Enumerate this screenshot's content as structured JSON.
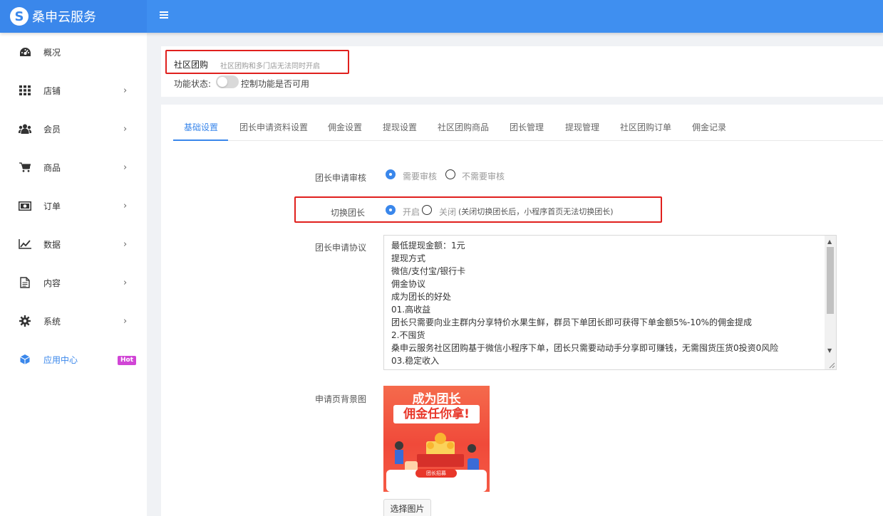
{
  "app": {
    "name": "桑申云服务",
    "logo_letter": "S"
  },
  "topbar": {
    "menu_icon": "hamburger-icon"
  },
  "sidebar": {
    "items": [
      {
        "label": "概况",
        "icon": "dashboard-icon",
        "arrow": ""
      },
      {
        "label": "店铺",
        "icon": "grid-icon",
        "arrow": "›"
      },
      {
        "label": "会员",
        "icon": "users-icon",
        "arrow": "›"
      },
      {
        "label": "商品",
        "icon": "cart-icon",
        "arrow": "›"
      },
      {
        "label": "订单",
        "icon": "money-icon",
        "arrow": "›"
      },
      {
        "label": "数据",
        "icon": "chart-line-icon",
        "arrow": "›"
      },
      {
        "label": "内容",
        "icon": "document-icon",
        "arrow": "›"
      },
      {
        "label": "系统",
        "icon": "gear-icon",
        "arrow": "›"
      },
      {
        "label": "应用中心",
        "icon": "cube-icon",
        "badge": "Hot",
        "active": true
      }
    ]
  },
  "header": {
    "title": "社区团购",
    "subtitle": "社区团购和多门店无法同时开启",
    "function_status_label": "功能状态:",
    "function_status_on": false,
    "function_status_hint": "控制功能是否可用"
  },
  "tabs": [
    "基础设置",
    "团长申请资料设置",
    "佣金设置",
    "提现设置",
    "社区团购商品",
    "团长管理",
    "提现管理",
    "社区团购订单",
    "佣金记录"
  ],
  "form": {
    "review": {
      "label": "团长申请审核",
      "option_on": "需要审核",
      "option_off": "不需要审核",
      "selected": "需要审核"
    },
    "switch_leader": {
      "label": "切换团长",
      "option_on": "开启",
      "option_off": "关闭",
      "hint": "(关闭切换团长后，小程序首页无法切换团长)",
      "selected": "开启"
    },
    "agreement": {
      "label": "团长申请协议",
      "lines": [
        "最低提现金额：1元",
        "提现方式",
        "微信/支付宝/银行卡",
        "佣金协议",
        "成为团长的好处",
        "01.高收益",
        "团长只需要向业主群内分享特价水果生鲜，群员下单团长即可获得下单金额5%-10%的佣金提成",
        "2.不囤货",
        "桑申云服务社区团购基于微信小程序下单，团长只需要动动手分享即可赚钱，无需囤货压货0投资0风险",
        "03.稳定收入"
      ]
    },
    "background": {
      "label": "申请页背景图",
      "image_title": "成为团长",
      "image_subtitle": "佣金任你拿!",
      "image_button": "团长招募",
      "button_label": "选择图片"
    }
  }
}
